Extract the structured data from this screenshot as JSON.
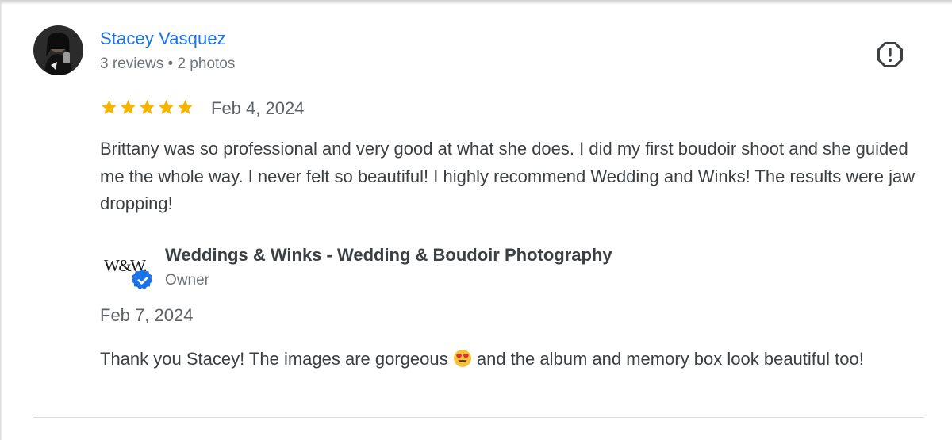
{
  "reviewer": {
    "name": "Stacey Vasquez",
    "meta": "3 reviews • 2 photos"
  },
  "review": {
    "rating": 5,
    "rating_max": 5,
    "date": "Feb 4, 2024",
    "text": "Brittany was so professional and very good at what she does. I did my first boudoir shoot and she guided me the whole way. I never felt so beautiful! I highly recommend Wedding and Winks! The results were jaw dropping!"
  },
  "owner": {
    "logo_text": "W&W.",
    "name": "Weddings & Winks - Wedding & Boudoir Photography",
    "role": "Owner",
    "verified_icon": "verified-badge-icon"
  },
  "reply": {
    "date": "Feb 7, 2024",
    "text_before_emoji": "Thank you Stacey! The images are gorgeous ",
    "emoji": "heart-eyes-emoji",
    "text_after_emoji": " and the album and memory box look beautiful too!"
  },
  "icons": {
    "report": "report-flag-icon",
    "star": "star-icon"
  },
  "colors": {
    "link": "#1a73e8",
    "star": "#f4b400",
    "verified": "#1a73e8",
    "text": "#3c4043",
    "muted": "#70757a"
  }
}
